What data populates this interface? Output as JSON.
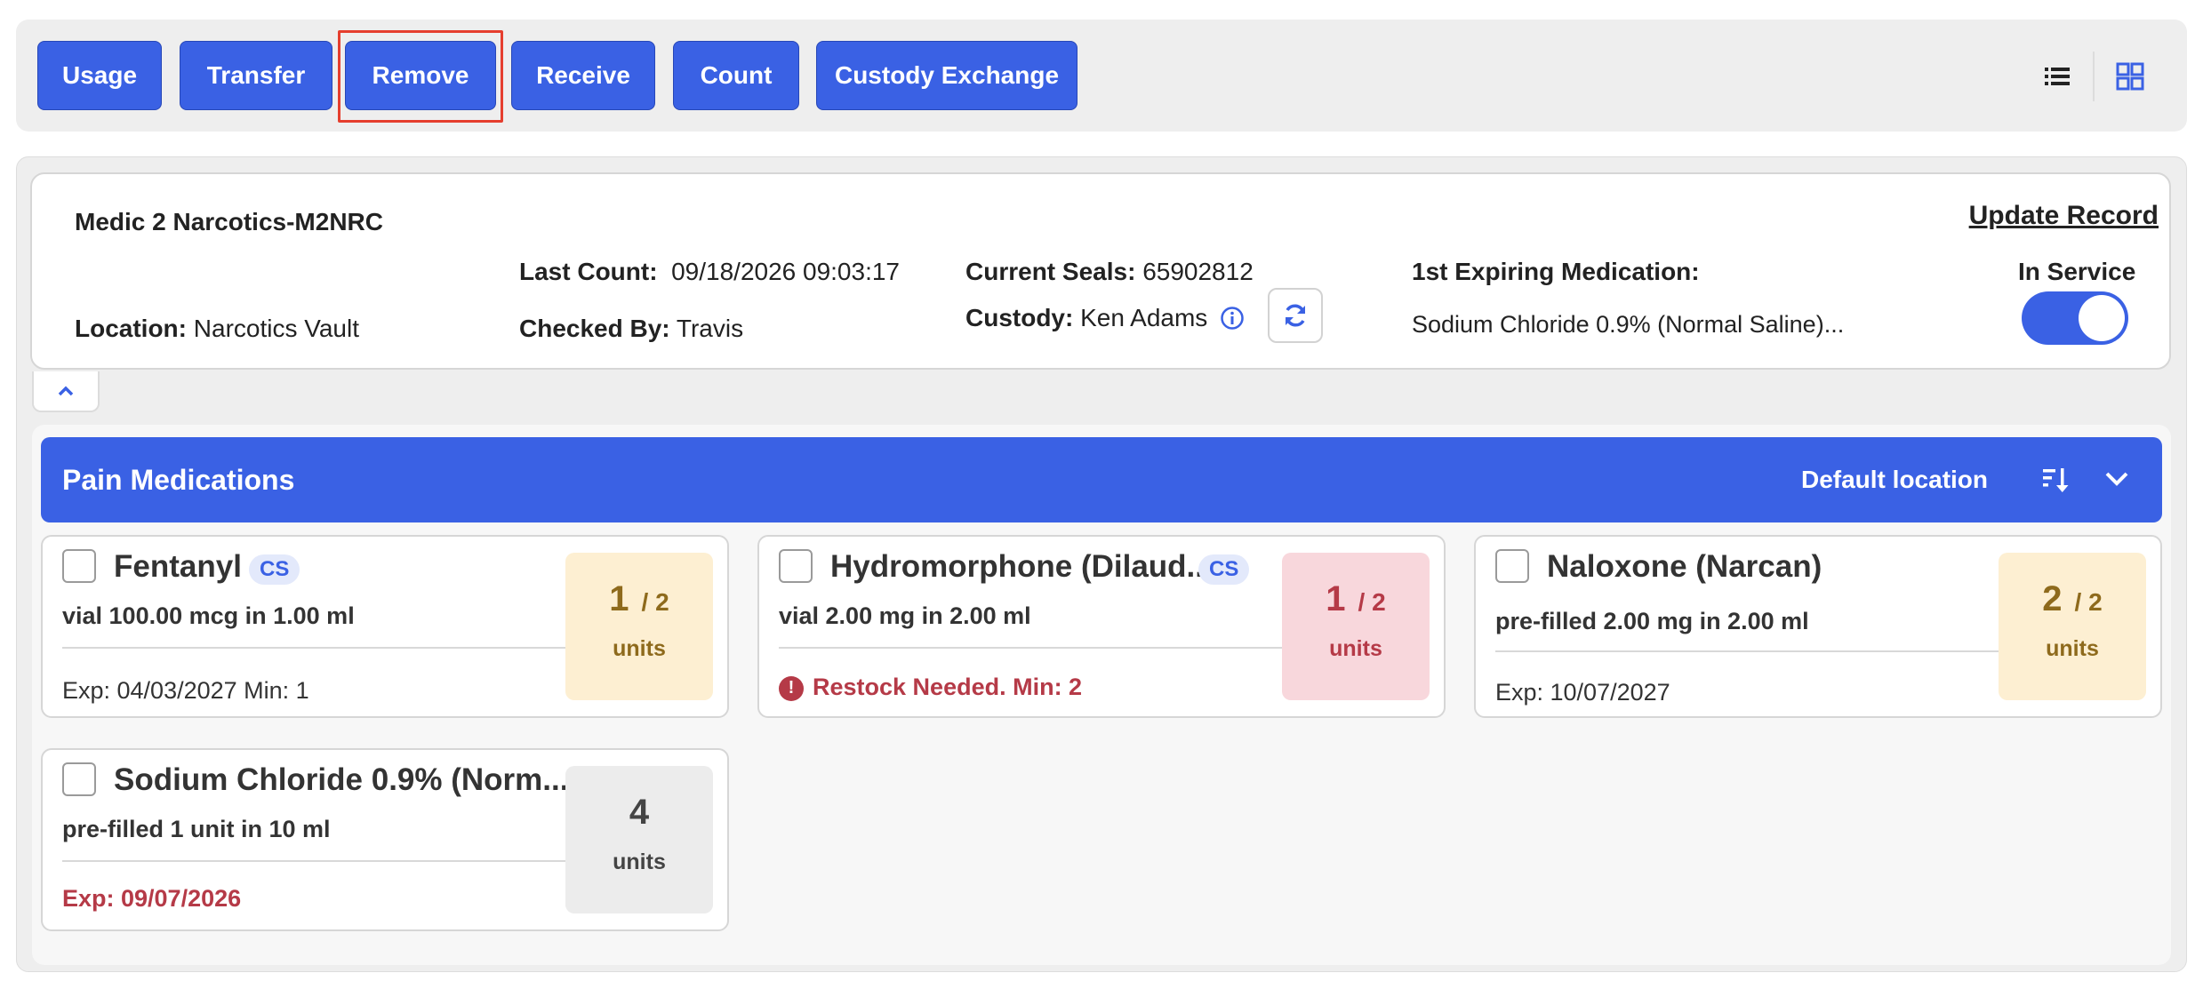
{
  "toolbar": {
    "buttons": [
      "Usage",
      "Transfer",
      "Remove",
      "Receive",
      "Count",
      "Custody Exchange"
    ]
  },
  "summary": {
    "unit_name": "Medic 2 Narcotics-M2NRC",
    "update_record": "Update Record",
    "location_label": "Location:",
    "location_value": "Narcotics Vault",
    "last_count_label": "Last Count:",
    "last_count_value": "09/18/2026 09:03:17",
    "checked_by_label": "Checked By:",
    "checked_by_value": "Travis",
    "current_seals_label": "Current Seals:",
    "current_seals_value": "65902812",
    "custody_label": "Custody:",
    "custody_value": "Ken Adams",
    "expiring_label": "1st Expiring Medication:",
    "expiring_value": "Sodium Chloride 0.9% (Normal Saline)...",
    "in_service_label": "In Service",
    "in_service": true
  },
  "section": {
    "title": "Pain Medications",
    "location": "Default location"
  },
  "cards": [
    {
      "name": "Fentanyl",
      "cs": "CS",
      "desc": "vial 100.00 mcg in 1.00 ml",
      "footer": "Exp: 04/03/2027 Min: 1",
      "qty": "1",
      "of": "/ 2",
      "units": "units"
    },
    {
      "name": "Hydromorphone (Dilaud...",
      "cs": "CS",
      "desc": "vial 2.00 mg in 2.00 ml",
      "footer": "Restock Needed.  Min: 2",
      "qty": "1",
      "of": "/ 2",
      "units": "units"
    },
    {
      "name": "Naloxone (Narcan)",
      "desc": "pre-filled 2.00 mg in 2.00 ml",
      "footer": "Exp: 10/07/2027",
      "qty": "2",
      "of": "/ 2",
      "units": "units"
    },
    {
      "name": "Sodium Chloride 0.9% (Norm...",
      "desc": "pre-filled 1 unit in 10 ml",
      "footer": "Exp: 09/07/2026",
      "qty": "4",
      "units": "units"
    }
  ],
  "colors": {
    "primary": "#3a61e4",
    "alert_red": "#b53a47",
    "warn_bg": "#fdefd2",
    "alert_bg": "#f8d7dc",
    "highlight": "#e53e2e"
  },
  "icons": [
    "list-view-icon",
    "grid-view-icon",
    "info-icon",
    "refresh-icon",
    "chevron-up-icon",
    "sort-icon",
    "chevron-down-icon",
    "alert-icon"
  ]
}
